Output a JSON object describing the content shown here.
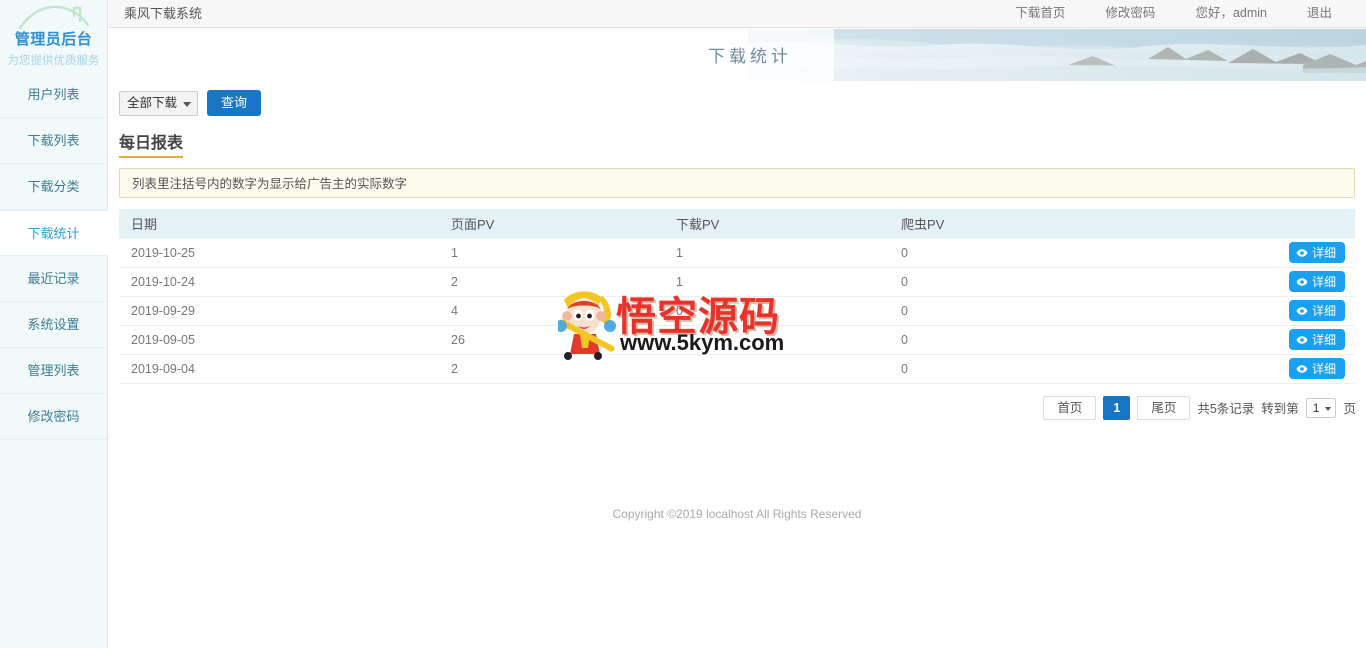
{
  "sidebar": {
    "brand_title": "管理员后台",
    "brand_sub": "为您提供优质服务",
    "roof_icon": "house-roof-icon",
    "items": [
      {
        "label": "用户列表",
        "active": false
      },
      {
        "label": "下载列表",
        "active": false
      },
      {
        "label": "下载分类",
        "active": false
      },
      {
        "label": "下载统计",
        "active": true
      },
      {
        "label": "最近记录",
        "active": false
      },
      {
        "label": "系统设置",
        "active": false
      },
      {
        "label": "管理列表",
        "active": false
      },
      {
        "label": "修改密码",
        "active": false
      }
    ]
  },
  "topbar": {
    "title": "乘风下载系统",
    "nav": [
      {
        "label": "下载首页",
        "type": "link"
      },
      {
        "label": "修改密码",
        "type": "link"
      },
      {
        "label": "您好，admin",
        "type": "text"
      },
      {
        "label": "退出",
        "type": "link"
      }
    ]
  },
  "banner": {
    "title": "下载统计"
  },
  "filters": {
    "select_value": "全部下载",
    "select_caret_icon": "chevron-down-icon",
    "query_label": "查询"
  },
  "report": {
    "section_title": "每日报表",
    "notice": "列表里注括号内的数字为显示给广告主的实际数字",
    "columns": [
      "日期",
      "页面PV",
      "下载PV",
      "爬虫PV",
      ""
    ],
    "detail_label": "详细",
    "detail_icon": "eye-icon",
    "rows": [
      {
        "date": "2019-10-25",
        "page_pv": "1",
        "download_pv": "1",
        "spider_pv": "0"
      },
      {
        "date": "2019-10-24",
        "page_pv": "2",
        "download_pv": "1",
        "spider_pv": "0"
      },
      {
        "date": "2019-09-29",
        "page_pv": "4",
        "download_pv": "0",
        "spider_pv": "0"
      },
      {
        "date": "2019-09-05",
        "page_pv": "26",
        "download_pv": "",
        "spider_pv": "0"
      },
      {
        "date": "2019-09-04",
        "page_pv": "2",
        "download_pv": "",
        "spider_pv": "0"
      }
    ]
  },
  "pagination": {
    "first_label": "首页",
    "current_page": "1",
    "last_label": "尾页",
    "total_text": "共5条记录",
    "jump_label": "转到第",
    "jump_value": "1",
    "jump_caret_icon": "chevron-down-icon",
    "page_unit": "页"
  },
  "footer": {
    "copyright": "Copyright ©2019 localhost All Rights Reserved"
  },
  "watermark": {
    "text": "悟空源码",
    "url": "www.5kym.com",
    "mascot_icon": "monkey-king-icon"
  },
  "colors": {
    "accent_blue": "#1a76c4",
    "detail_blue": "#19a0f0",
    "sidebar_bg": "#f2f9fb",
    "table_header": "#e4f2f6",
    "notice_bg": "#fcfbee",
    "underline_orange": "#eaa844",
    "watermark_red": "#e8322a"
  }
}
